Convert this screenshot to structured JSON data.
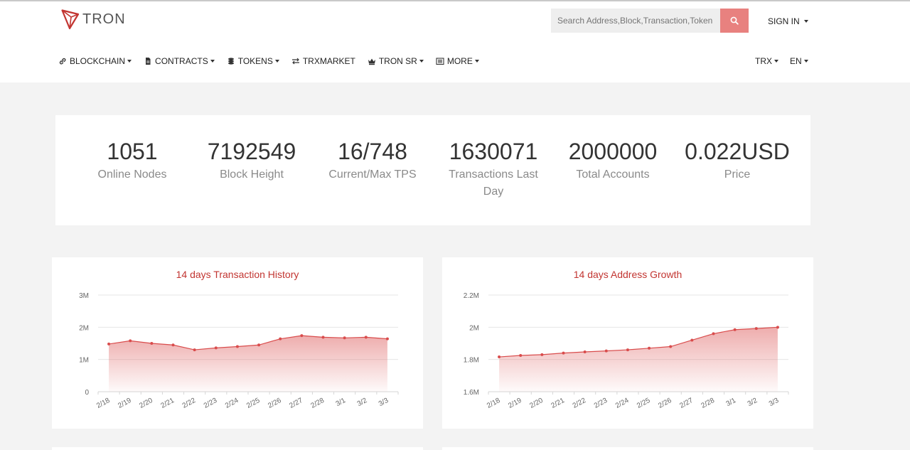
{
  "brand": {
    "name": "TRON"
  },
  "search": {
    "placeholder": "Search Address,Block,Transaction,Token"
  },
  "header": {
    "signin_label": "SIGN IN"
  },
  "nav": {
    "items": [
      {
        "label": "BLOCKCHAIN",
        "icon": "link-icon",
        "dropdown": true
      },
      {
        "label": "CONTRACTS",
        "icon": "document-icon",
        "dropdown": true
      },
      {
        "label": "TOKENS",
        "icon": "coins-icon",
        "dropdown": true
      },
      {
        "label": "TRXMARKET",
        "icon": "exchange-icon",
        "dropdown": false
      },
      {
        "label": "TRON SR",
        "icon": "crown-icon",
        "dropdown": true
      },
      {
        "label": "MORE",
        "icon": "list-icon",
        "dropdown": true
      }
    ],
    "currency": "TRX",
    "language": "EN"
  },
  "stats": [
    {
      "value": "1051",
      "label": "Online Nodes"
    },
    {
      "value": "7192549",
      "label": "Block Height"
    },
    {
      "value": "16/748",
      "label": "Current/Max TPS"
    },
    {
      "value": "1630071",
      "label": "Transactions Last Day"
    },
    {
      "value": "2000000",
      "label": "Total Accounts"
    },
    {
      "value": "0.022USD",
      "label": "Price"
    }
  ],
  "colors": {
    "accent": "#c23531",
    "search_button": "#e8817f"
  },
  "chart_data": [
    {
      "type": "area",
      "title": "14 days Transaction History",
      "x": [
        "2/18",
        "2/19",
        "2/20",
        "2/21",
        "2/22",
        "2/23",
        "2/24",
        "2/25",
        "2/26",
        "2/27",
        "2/28",
        "3/1",
        "3/2",
        "3/3"
      ],
      "values": [
        1480000,
        1580000,
        1500000,
        1450000,
        1300000,
        1360000,
        1400000,
        1450000,
        1640000,
        1740000,
        1690000,
        1670000,
        1690000,
        1640000
      ],
      "yticks": [
        "0",
        "1M",
        "2M",
        "3M"
      ],
      "ylim": [
        0,
        3000000
      ],
      "grid": true
    },
    {
      "type": "area",
      "title": "14 days Address Growth",
      "x": [
        "2/18",
        "2/19",
        "2/20",
        "2/21",
        "2/22",
        "2/23",
        "2/24",
        "2/25",
        "2/26",
        "2/27",
        "2/28",
        "3/1",
        "3/2",
        "3/3"
      ],
      "values": [
        1816000,
        1825000,
        1830000,
        1840000,
        1847000,
        1853000,
        1860000,
        1870000,
        1880000,
        1920000,
        1960000,
        1985000,
        1992000,
        2000000
      ],
      "yticks": [
        "1.6M",
        "1.8M",
        "2M",
        "2.2M"
      ],
      "ylim": [
        1600000,
        2200000
      ],
      "grid": true
    }
  ]
}
